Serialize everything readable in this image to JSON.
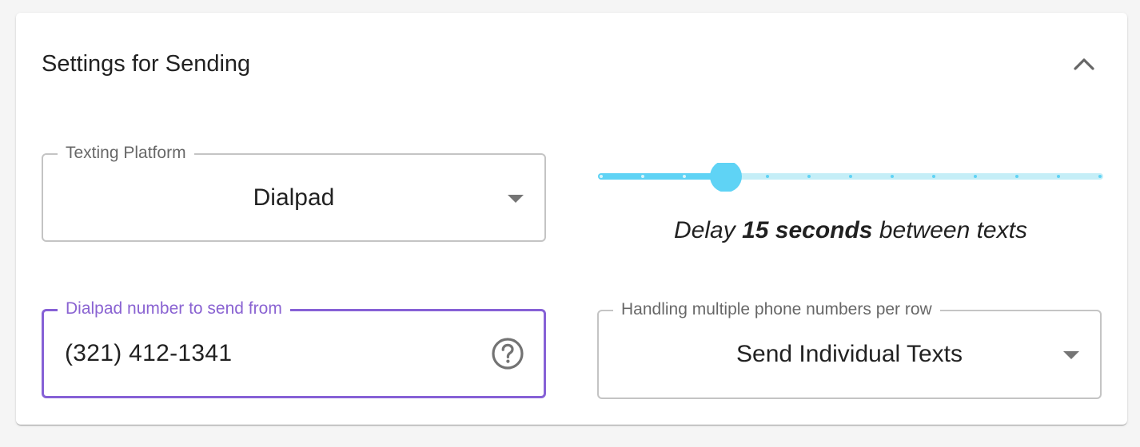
{
  "settings": {
    "title": "Settings for Sending",
    "collapse_icon": "chevron-up-icon",
    "platform": {
      "label": "Texting Platform",
      "value": "Dialpad"
    },
    "delay": {
      "value_seconds": 15,
      "caption_prefix": "Delay",
      "caption_value": "15 seconds",
      "caption_suffix": "between texts",
      "track_color": "#c5eef7",
      "active_color": "#5fd3f5"
    },
    "send_from": {
      "label": "Dialpad number to send from",
      "value": "(321) 412-1341",
      "help_icon": "help-circle-icon",
      "focus_color": "#8661d6"
    },
    "multiple_numbers": {
      "label": "Handling multiple phone numbers per row",
      "value": "Send Individual Texts"
    }
  }
}
